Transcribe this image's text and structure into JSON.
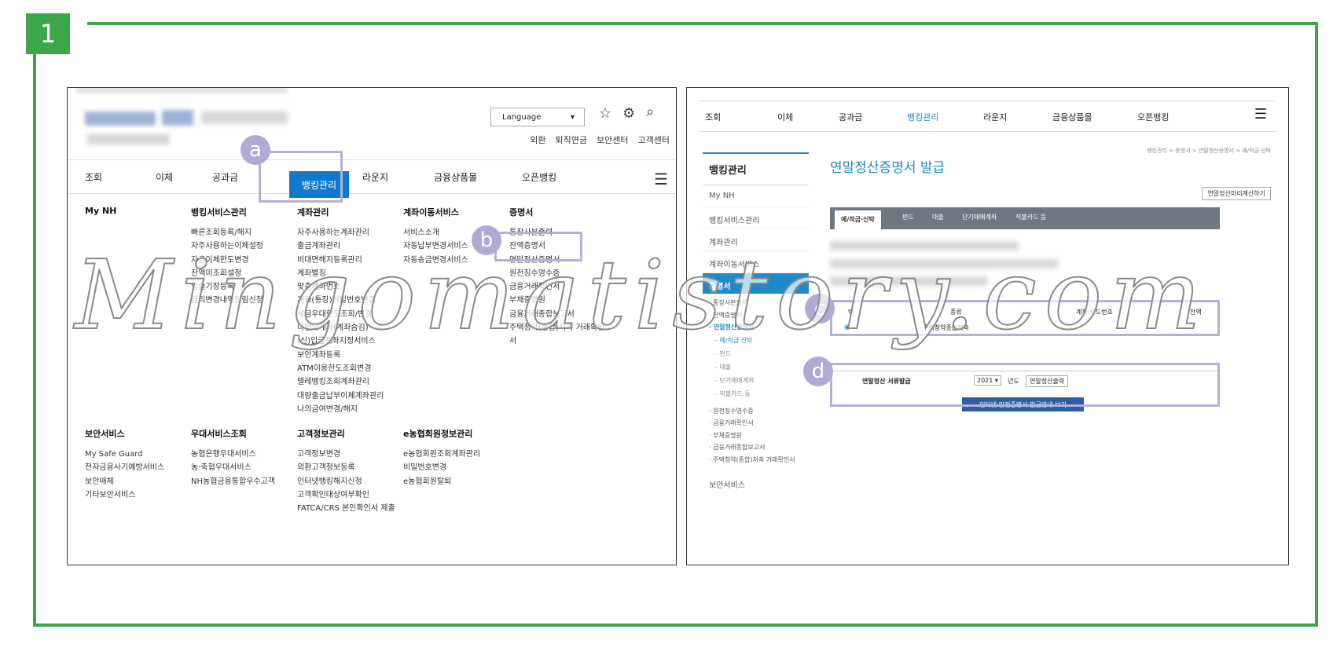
{
  "step_number": "1",
  "left_panel": {
    "language_label": "Language",
    "util_links": [
      "외환",
      "퇴직연금",
      "보안센터",
      "고객센터"
    ],
    "nav": [
      "조회",
      "이체",
      "공과금",
      "뱅킹관리",
      "라운지",
      "금융상품몰",
      "오픈뱅킹"
    ],
    "columns": [
      {
        "header": "My NH",
        "items": []
      },
      {
        "header": "뱅킹서비스관리",
        "items": [
          "빠른조회등록/해지",
          "자주사용하는이체설정",
          "자금이체한도변경",
          "잔액미조회설정",
          "입출기장등록",
          "금리변경내역알림신청"
        ]
      },
      {
        "header": "계좌관리",
        "items": [
          "자주사용하는계좌관리",
          "출금계좌관리",
          "비대면해지등록관리",
          "계좌별칭",
          "맞춤계좌번호",
          "계좌(통장)비밀번호변경",
          "세금우대한도조회/변경",
          "나만의계좌(계좌숨김)",
          "(신)입금계좌지정서비스",
          "보안계좌등록",
          "ATM이용한도조회변경",
          "텔레뱅킹조회계좌관리",
          "대량출금납부이체계좌관리",
          "나의금여변경/해지"
        ]
      },
      {
        "header": "계좌이동서비스",
        "items": [
          "서비스소개",
          "자동납부변경서비스",
          "자동송금변경서비스"
        ]
      },
      {
        "header": "증명서",
        "items": [
          "통장사본출력",
          "잔액증명서",
          "연말정산증명서",
          "원천징수영수증",
          "금융거래확인서",
          "부채증명원",
          "금융거래종합보고서",
          "주택청약(종합)저축 거래확인서"
        ]
      }
    ],
    "columns2": [
      {
        "header": "보안서비스",
        "items": [
          "My Safe Guard",
          "전자금융사기예방서비스",
          "보안매체",
          "기타보안서비스"
        ]
      },
      {
        "header": "우대서비스조회",
        "items": [
          "농협은행우대서비스",
          "농·축협우대서비스",
          "NH농협금융통합우수고객"
        ]
      },
      {
        "header": "고객정보관리",
        "items": [
          "고객정보변경",
          "외환고객정보등록",
          "인터넷뱅킹해지신청",
          "고객확인대상여부확인",
          "FATCA/CRS 본인확인서 제출"
        ]
      },
      {
        "header": "e농협회원정보관리",
        "items": [
          "e농협회원조회계좌관리",
          "비밀번호변경",
          "e농협회원탈퇴"
        ]
      }
    ]
  },
  "markers": {
    "a": "a",
    "b": "b",
    "c": "c",
    "d": "d"
  },
  "watermark": "Mingomatistory.com",
  "right_panel": {
    "nav": [
      "조회",
      "이체",
      "공과금",
      "뱅킹관리",
      "라운지",
      "금융상품몰",
      "오픈뱅킹"
    ],
    "breadcrumb": "뱅킹관리 > 증명서 > 연말정산증명서 > 예/적금·신탁",
    "page_title": "연말정산증명서 발급",
    "preview_button": "연말정산미리계산하기",
    "sidebar_title": "뱅킹관리",
    "sidebar_items": [
      "My NH",
      "뱅킹서비스관리",
      "계좌관리",
      "계좌이동서비스"
    ],
    "sidebar_active": "증명서",
    "sidebar_sub": [
      "통장사본출력",
      "잔액증명서",
      "연말정산증명서"
    ],
    "sidebar_subsub": [
      "예/적금·신탁",
      "펀드",
      "대출",
      "단기매매계좌",
      "직불카드 등"
    ],
    "sidebar_sub2": [
      "원천징수영수증",
      "금융거래확인서",
      "부채증명원",
      "금융거래종합보고서",
      "주택청약(종합)저축 거래확인서"
    ],
    "sidebar_bottom": "보안서비스",
    "tabs": [
      "예/적금·신탁",
      "펀드",
      "대출",
      "단기매매계좌",
      "직불카드 등"
    ],
    "table_headers": [
      "택",
      "종류",
      "계좌/카드번호",
      "잔액"
    ],
    "table_row_type": "주택청약종합저축",
    "issue_label": "연말정산 서류발급",
    "year_value": "2021",
    "year_suffix": "년도",
    "issue_button": "연말정산출력",
    "guide_button": "인터넷 안전증명서 발급안내 보기"
  }
}
